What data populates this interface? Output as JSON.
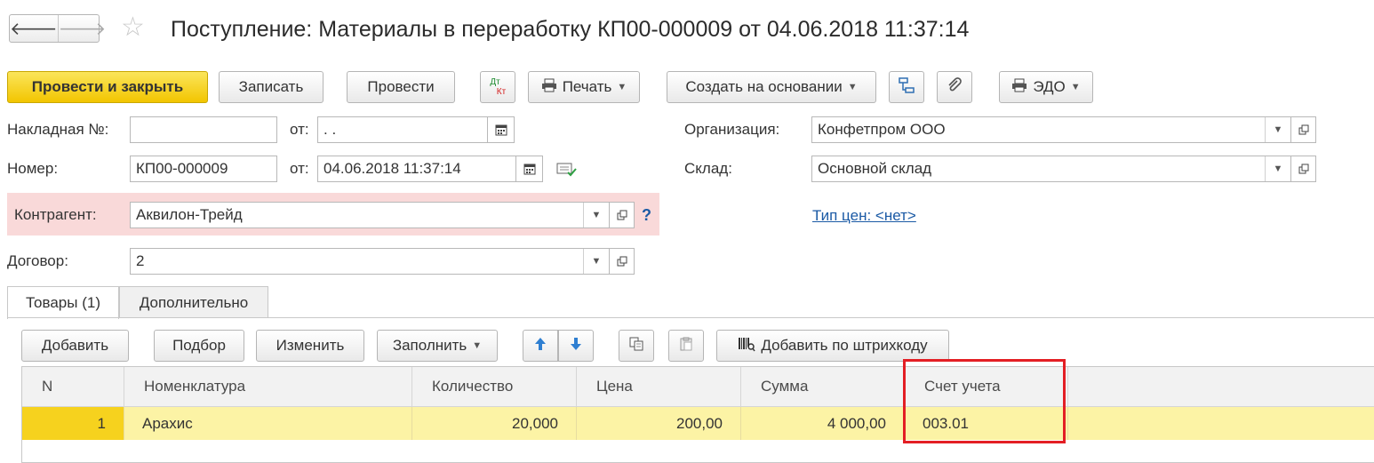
{
  "window": {
    "title": "Поступление: Материалы в переработку КП00-000009 от 04.06.2018 11:37:14",
    "nav_back": "🡐",
    "nav_forward": "🡒",
    "star": "☆"
  },
  "toolbar": {
    "post_close": "Провести и закрыть",
    "save": "Записать",
    "post": "Провести",
    "dtkt_top": "Дт",
    "dtkt_bottom": "Кт",
    "print": "Печать",
    "create_based": "Создать на основании",
    "edo": "ЭДО"
  },
  "form": {
    "invoice_label": "Накладная  №:",
    "invoice_value": "",
    "invoice_date_label": "от:",
    "invoice_date_value": " .  .",
    "number_label": "Номер:",
    "number_value": "КП00-000009",
    "number_date_label": "от:",
    "number_date_value": "04.06.2018 11:37:14",
    "counterparty_label": "Контрагент:",
    "counterparty_value": "Аквилон-Трейд",
    "help": "?",
    "contract_label": "Договор:",
    "contract_value": "2",
    "org_label": "Организация:",
    "org_value": "Конфетпром ООО",
    "warehouse_label": "Склад:",
    "warehouse_value": "Основной склад",
    "price_type_link": "Тип цен: <нет>"
  },
  "tabs": [
    {
      "label": "Товары (1)",
      "active": true
    },
    {
      "label": "Дополнительно",
      "active": false
    }
  ],
  "table_toolbar": {
    "add": "Добавить",
    "pick": "Подбор",
    "edit": "Изменить",
    "fill": "Заполнить",
    "add_barcode": "Добавить по штрихкоду"
  },
  "table": {
    "columns": [
      "N",
      "Номенклатура",
      "Количество",
      "Цена",
      "Сумма",
      "Счет учета"
    ],
    "rows": [
      {
        "n": "1",
        "item": "Арахис",
        "qty": "20,000",
        "price": "200,00",
        "sum": "4 000,00",
        "account": "003.01"
      }
    ]
  },
  "colors": {
    "primary_button": "#f2c500",
    "required_highlight": "#f9d9d9",
    "selected_row": "#fcf3a5",
    "annotation_box": "#e31e24",
    "link": "#1b5aa5"
  }
}
